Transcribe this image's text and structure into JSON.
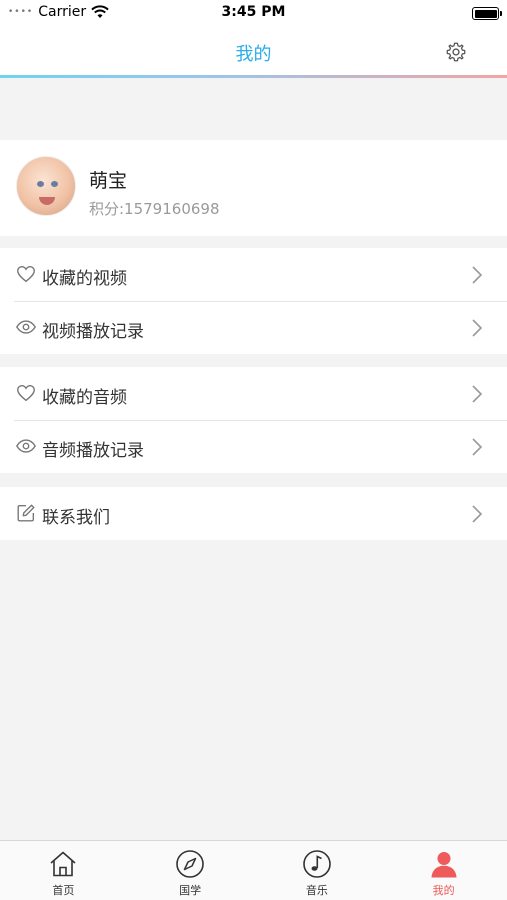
{
  "status_bar": {
    "carrier": "Carrier",
    "time": "3:45 PM",
    "signal_dots": "••••",
    "battery_level": 1.0
  },
  "nav": {
    "title": "我的",
    "title_color": "#29aee6",
    "settings_icon": "gear-icon"
  },
  "profile": {
    "name": "萌宝",
    "points": "积分:1579160698"
  },
  "menu_groups": [
    {
      "items": [
        {
          "label": "收藏的视频",
          "icon": "heart-icon"
        },
        {
          "label": "视频播放记录",
          "icon": "eye-icon"
        }
      ]
    },
    {
      "items": [
        {
          "label": "收藏的音频",
          "icon": "heart-icon"
        },
        {
          "label": "音频播放记录",
          "icon": "eye-icon"
        }
      ]
    },
    {
      "items": [
        {
          "label": "联系我们",
          "icon": "edit-icon"
        }
      ]
    }
  ],
  "tab_bar": {
    "active_color": "#ef5a5a",
    "tabs": [
      {
        "label": "首页",
        "icon": "home-icon",
        "active": false
      },
      {
        "label": "国学",
        "icon": "compass-icon",
        "active": false
      },
      {
        "label": "音乐",
        "icon": "music-note-icon",
        "active": false
      },
      {
        "label": "我的",
        "icon": "user-icon",
        "active": true
      }
    ]
  }
}
